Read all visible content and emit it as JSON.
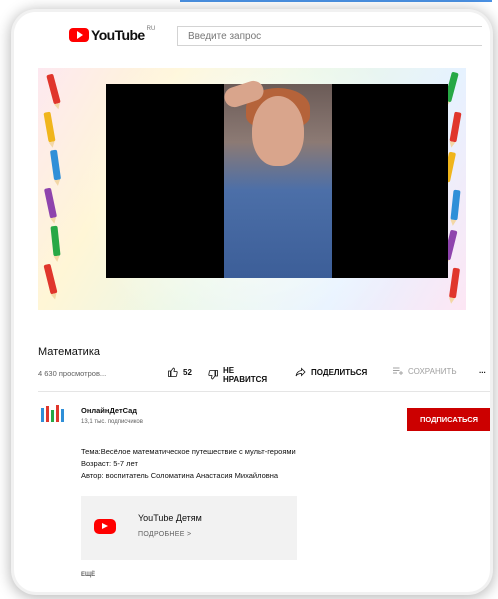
{
  "header": {
    "logo_text": "YouTube",
    "logo_region": "RU",
    "search_placeholder": "Введите запрос"
  },
  "video": {
    "title": "Математика",
    "views": "4 630 просмотров...",
    "likes": "52",
    "dislike_label_line1": "НЕ",
    "dislike_label_line2": "НРАВИТСЯ",
    "share_label": "ПОДЕЛИТЬСЯ",
    "save_label": "СОХРАНИТЬ",
    "more_label": "..."
  },
  "channel": {
    "name": "ОнлайнДетСад",
    "subscribers": "13,1 тыс. подписчиков",
    "subscribe_label": "ПОДПИСАТЬСЯ"
  },
  "description": {
    "line1": "Тема:Весёлое математическое путешествие с мульт-героями",
    "line2": "Возраст: 5-7 лет",
    "line3": "Автор: воспитатель Соломатина Анастасия Михайловна"
  },
  "kids_card": {
    "name": "YouTube Детям",
    "more": "ПОДРОБНЕЕ >"
  },
  "show_more": "ЕЩЁ",
  "colors": {
    "accent": "#cc0000",
    "link_line": "#4a90e2"
  }
}
